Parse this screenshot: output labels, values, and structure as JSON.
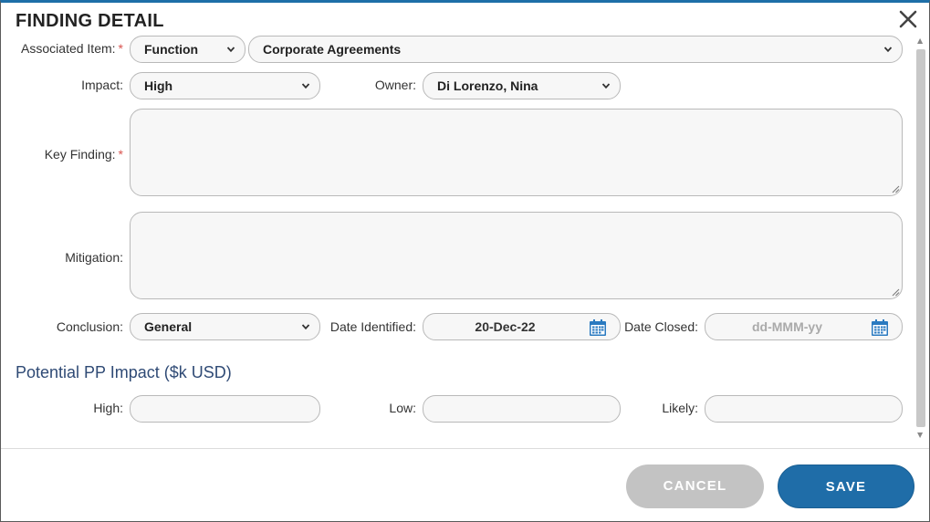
{
  "dialog": {
    "title": "FINDING DETAIL",
    "close_icon": "close-icon"
  },
  "form": {
    "associated_item": {
      "label": "Associated Item:",
      "required_mark": "*",
      "type_value": "Function",
      "item_value": "Corporate Agreements"
    },
    "impact": {
      "label": "Impact:",
      "value": "High"
    },
    "owner": {
      "label": "Owner:",
      "value": "Di Lorenzo, Nina"
    },
    "key_finding": {
      "label": "Key Finding:",
      "required_mark": "*",
      "value": ""
    },
    "mitigation": {
      "label": "Mitigation:",
      "value": ""
    },
    "conclusion": {
      "label": "Conclusion:",
      "value": "General"
    },
    "date_identified": {
      "label": "Date Identified:",
      "value": "20-Dec-22"
    },
    "date_closed": {
      "label": "Date Closed:",
      "placeholder": "dd-MMM-yy"
    }
  },
  "potential_impact": {
    "heading": "Potential PP Impact ($k USD)",
    "high": {
      "label": "High:",
      "value": ""
    },
    "low": {
      "label": "Low:",
      "value": ""
    },
    "likely": {
      "label": "Likely:",
      "value": ""
    }
  },
  "footer": {
    "cancel_label": "CANCEL",
    "save_label": "SAVE"
  },
  "colors": {
    "accent": "#1f6da8",
    "required": "#d9534f",
    "section_heading": "#2f4a75",
    "cancel_bg": "#c3c3c3",
    "calendar_icon": "#2a7ac0"
  }
}
